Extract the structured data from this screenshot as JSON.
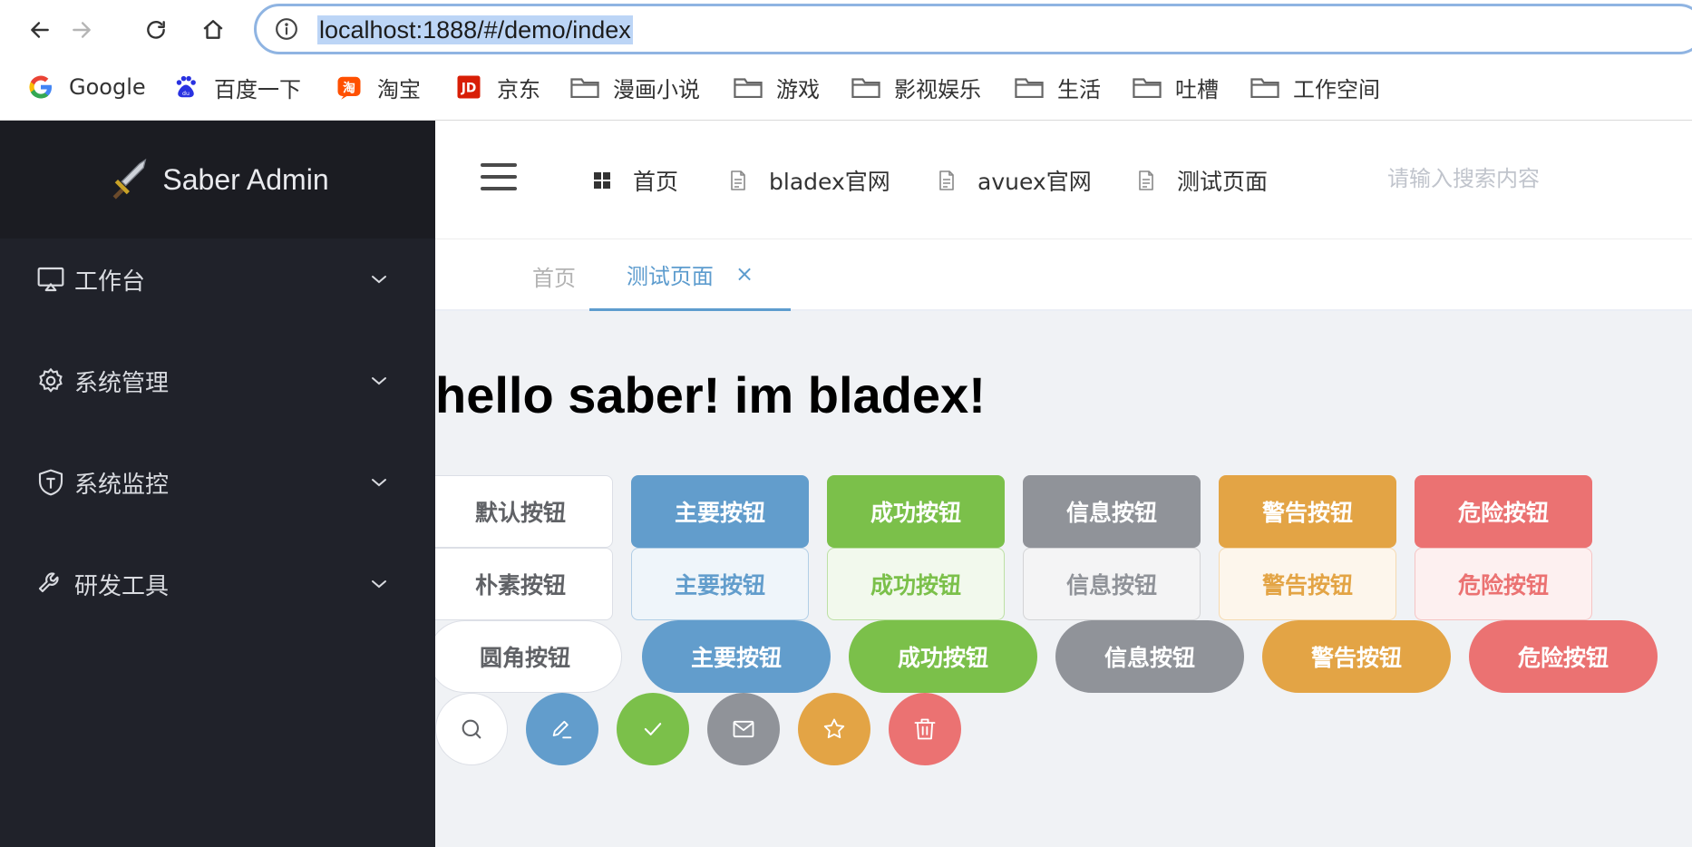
{
  "browser": {
    "url": "localhost:1888/#/demo/index",
    "bookmarks": [
      {
        "label": "Google",
        "icon": "google-icon"
      },
      {
        "label": "百度一下",
        "icon": "baidu-icon"
      },
      {
        "label": "淘宝",
        "icon": "taobao-icon"
      },
      {
        "label": "京东",
        "icon": "jd-icon"
      },
      {
        "label": "漫画小说",
        "icon": "folder-icon"
      },
      {
        "label": "游戏",
        "icon": "folder-icon"
      },
      {
        "label": "影视娱乐",
        "icon": "folder-icon"
      },
      {
        "label": "生活",
        "icon": "folder-icon"
      },
      {
        "label": "吐槽",
        "icon": "folder-icon"
      },
      {
        "label": "工作空间",
        "icon": "folder-icon"
      }
    ]
  },
  "sidebar": {
    "logo_text": "Saber Admin",
    "items": [
      {
        "label": "工作台",
        "icon": "monitor-icon"
      },
      {
        "label": "系统管理",
        "icon": "gear-icon"
      },
      {
        "label": "系统监控",
        "icon": "shield-icon"
      },
      {
        "label": "研发工具",
        "icon": "wrench-icon"
      }
    ]
  },
  "header": {
    "nav": [
      {
        "label": "首页",
        "icon": "grid-icon"
      },
      {
        "label": "bladex官网",
        "icon": "document-icon"
      },
      {
        "label": "avuex官网",
        "icon": "document-icon"
      },
      {
        "label": "测试页面",
        "icon": "document-icon"
      }
    ],
    "search_placeholder": "请输入搜索内容"
  },
  "tags": {
    "items": [
      {
        "label": "首页",
        "active": false
      },
      {
        "label": "测试页面",
        "active": true
      }
    ],
    "close_symbol": "×"
  },
  "main": {
    "title": "hello saber! im bladex!",
    "default_buttons": [
      "默认按钮",
      "主要按钮",
      "成功按钮",
      "信息按钮",
      "警告按钮",
      "危险按钮"
    ],
    "plain_buttons": [
      "朴素按钮",
      "主要按钮",
      "成功按钮",
      "信息按钮",
      "警告按钮",
      "危险按钮"
    ],
    "round_buttons": [
      "圆角按钮",
      "主要按钮",
      "成功按钮",
      "信息按钮",
      "警告按钮",
      "危险按钮"
    ],
    "circle_buttons": [
      "search-icon",
      "edit-icon",
      "check-icon",
      "message-icon",
      "star-icon",
      "delete-icon"
    ]
  },
  "colors": {
    "primary": "#629dcc",
    "success": "#7bc04a",
    "info": "#909399",
    "warning": "#e3a445",
    "danger": "#eb7272",
    "sidebar_bg": "#20222a"
  }
}
